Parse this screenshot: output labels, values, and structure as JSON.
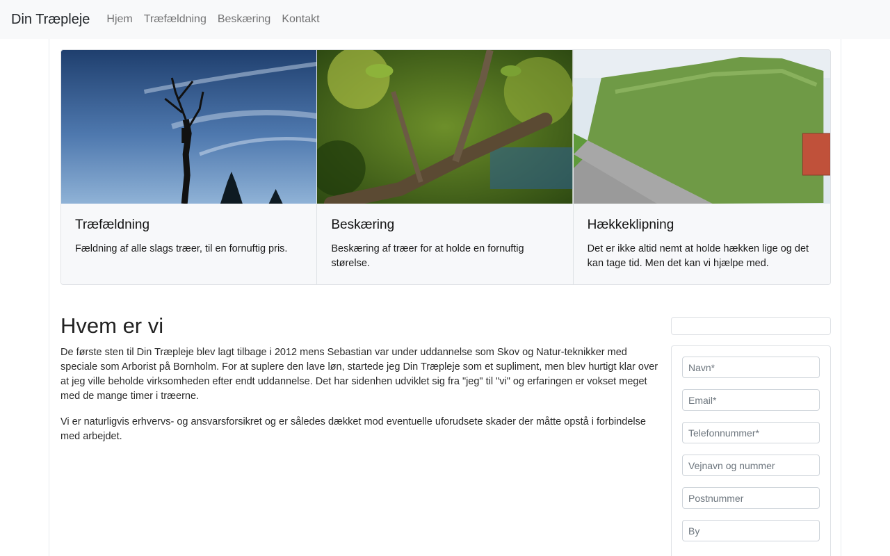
{
  "nav": {
    "brand": "Din Træpleje",
    "links": [
      "Hjem",
      "Træfældning",
      "Beskæring",
      "Kontakt"
    ]
  },
  "cards": [
    {
      "title": "Træfældning",
      "text": "Fældning af alle slags træer, til en fornuftig pris."
    },
    {
      "title": "Beskæring",
      "text": "Beskæring af træer for at holde en fornuftig størelse."
    },
    {
      "title": "Hækkeklipning",
      "text": "Det er ikke altid nemt at holde hækken lige og det kan tage tid. Men det kan vi hjælpe med."
    }
  ],
  "about": {
    "heading": "Hvem er vi",
    "paragraphs": [
      "De første sten til Din Træpleje blev lagt tilbage i 2012 mens Sebastian var under uddannelse som Skov og Natur-teknikker med speciale som Arborist på Bornholm. For at suplere den lave løn, startede jeg Din Træpleje som et supliment, men blev hurtigt klar over at jeg ville beholde virksomheden efter endt uddannelse. Det har sidenhen udviklet sig fra \"jeg\" til \"vi\" og erfaringen er vokset meget med de mange timer i træerne.",
      "Vi er naturligvis erhvervs- og ansvarsforsikret og er således dækket mod eventuelle uforudsete skader der måtte opstå i forbindelse med arbejdet."
    ]
  },
  "form": {
    "name_placeholder": "Navn*",
    "email_placeholder": "Email*",
    "phone_placeholder": "Telefonnummer*",
    "street_placeholder": "Vejnavn og nummer",
    "zip_placeholder": "Postnummer",
    "city_placeholder": "By"
  },
  "colors": {
    "navbar_bg": "#f8f9fa",
    "card_bg": "#f7f8fa",
    "nav_link": "#707070"
  }
}
